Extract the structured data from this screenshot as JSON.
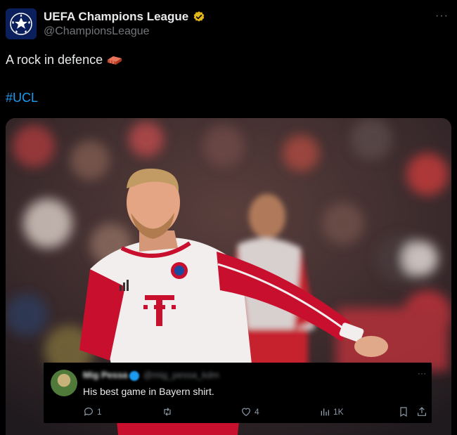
{
  "account": {
    "name": "UEFA Champions League",
    "handle": "@ChampionsLeague",
    "more_label": "···"
  },
  "tweet": {
    "text": "A rock in defence",
    "emoji_icon": "brick-icon",
    "hashtag": "#UCL"
  },
  "reply": {
    "author_name": "Mig Pessa",
    "author_handle": "@mig_pessa_kdm",
    "more_label": "···",
    "text": "His best game in Bayern shirt.",
    "actions": {
      "replies": "1",
      "retweets": "",
      "likes": "4",
      "views": "1K"
    }
  },
  "colors": {
    "link": "#1d9bf0",
    "background": "#000000",
    "secondary_text": "#71767b",
    "verified_gold": "#e2b719",
    "bayern_red": "#d10a1e"
  }
}
